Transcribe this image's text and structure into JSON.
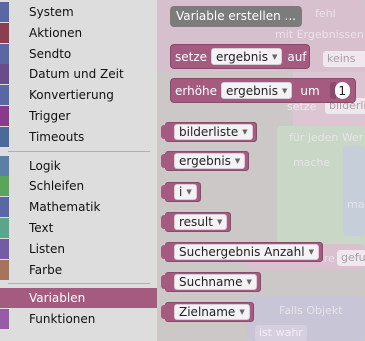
{
  "colors": {
    "toolbox_bg": "#dddddd",
    "workspace_bg": "#ccc8c8",
    "variable_block": "#a55b80",
    "variable_block_dark": "#8a4a6b",
    "selected_category": "#a55b80"
  },
  "toolbox": {
    "categories": [
      {
        "label": "System",
        "color": "#5b67a5"
      },
      {
        "label": "Aktionen",
        "color": "#8e3c4f"
      },
      {
        "label": "Sendto",
        "color": "#5b67a5"
      },
      {
        "label": "Datum und Zeit",
        "color": "#6b4c8a"
      },
      {
        "label": "Konvertierung",
        "color": "#5b67a5"
      },
      {
        "label": "Trigger",
        "color": "#8a3a8a"
      },
      {
        "label": "Timeouts",
        "color": "#4a6b9a"
      },
      {
        "label": "Logik",
        "color": "#5b80a5"
      },
      {
        "label": "Schleifen",
        "color": "#5ba55b"
      },
      {
        "label": "Mathematik",
        "color": "#5b67a5"
      },
      {
        "label": "Text",
        "color": "#5ba58c"
      },
      {
        "label": "Listen",
        "color": "#745ba5"
      },
      {
        "label": "Farbe",
        "color": "#a5745b"
      },
      {
        "label": "Variablen",
        "color": "#a55b80"
      },
      {
        "label": "Funktionen",
        "color": "#995ba5"
      }
    ],
    "selected": "Variablen"
  },
  "flyout": {
    "create_variable_button": "Variable erstellen ...",
    "set_block": {
      "prefix": "setze",
      "variable": "ergebnis",
      "suffix": "auf"
    },
    "change_block": {
      "prefix": "erhöhe",
      "variable": "ergebnis",
      "suffix": "um",
      "value": "1"
    },
    "variables": [
      "bilderliste",
      "ergebnis",
      "i",
      "result",
      "Suchergebnis Anzahl",
      "Suchname",
      "Zielname"
    ]
  },
  "workspace_ghost": {
    "texts": [
      "fehl",
      "mit Ergebnissen",
      "keins",
      "setze",
      "bilderli",
      "für jeden Wer",
      "mache",
      "ma",
      "ere",
      "gefu",
      "Falls Objekt",
      "ist wahr"
    ]
  }
}
